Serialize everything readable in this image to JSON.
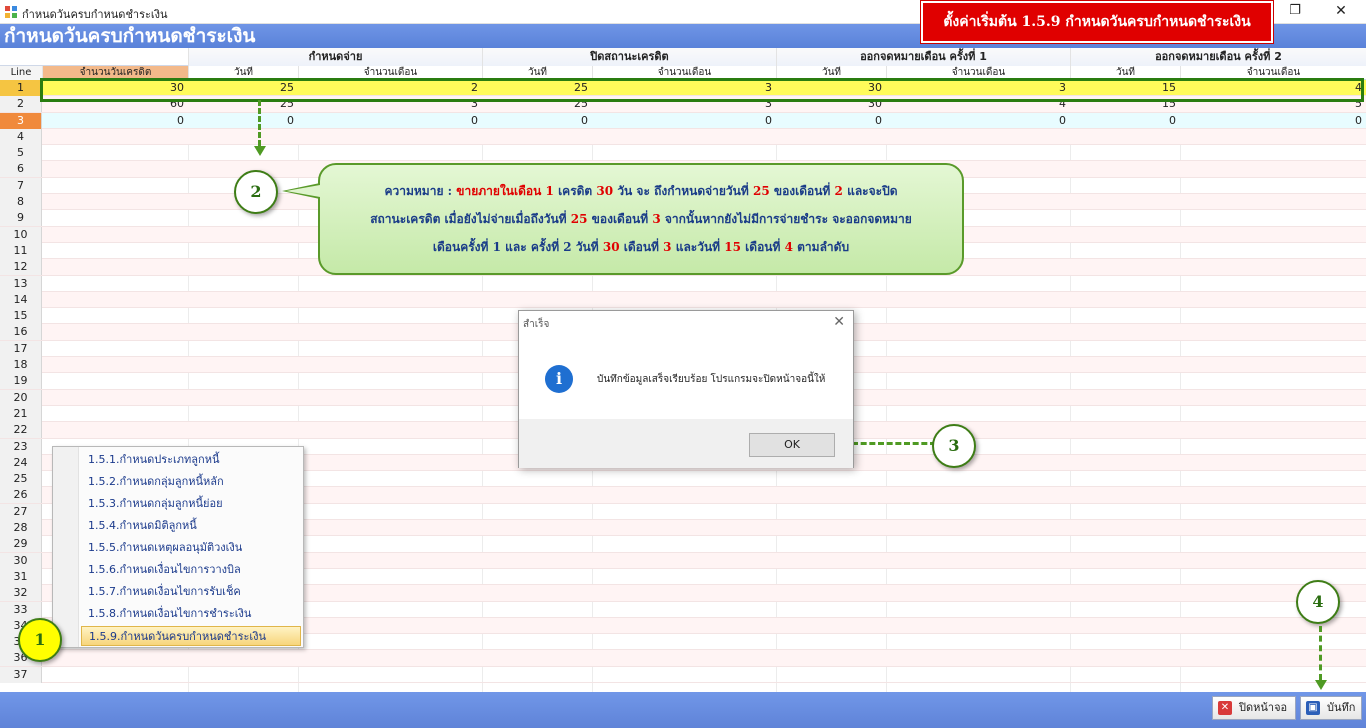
{
  "window": {
    "title": "กำหนดวันครบกำหนดชำระเงิน",
    "restore_glyph": "❐",
    "close_glyph": "✕"
  },
  "banner": {
    "text": "ตั้งค่าเริ่มต้น 1.5.9 กำหนดวันครบกำหนดชำระเงิน",
    "color": "#e00000"
  },
  "form": {
    "title": "กำหนดวันครบกำหนดชำระเงิน",
    "header_color": "#5a82d9"
  },
  "grid": {
    "line_header": "Line",
    "groups": [
      "กำหนดจ่าย",
      "ปิดสถานะเครดิต",
      "ออกจดหมายเดือน ครั้งที่ 1",
      "ออกจดหมายเดือน ครั้งที่ 2"
    ],
    "columns": [
      "จำนวนวันเครดิต",
      "วันที่",
      "จำนวนเดือน",
      "วันที่",
      "จำนวนเดือน",
      "วันที่",
      "จำนวนเดือน",
      "วันที่",
      "จำนวนเดือน"
    ],
    "rows": [
      [
        "30",
        "25",
        "2",
        "25",
        "3",
        "30",
        "3",
        "15",
        "4"
      ],
      [
        "60",
        "25",
        "3",
        "25",
        "3",
        "30",
        "4",
        "15",
        "5"
      ],
      [
        "0",
        "0",
        "0",
        "0",
        "0",
        "0",
        "0",
        "0",
        "0"
      ]
    ],
    "line_numbers": [
      "1",
      "2",
      "3",
      "4",
      "5",
      "6",
      "7",
      "8",
      "9",
      "10",
      "11",
      "12",
      "13",
      "14",
      "15",
      "16",
      "17",
      "18",
      "19",
      "20",
      "21",
      "22",
      "23",
      "24",
      "25",
      "26",
      "27",
      "28",
      "29",
      "30",
      "31",
      "32",
      "33",
      "34",
      "35",
      "36",
      "37"
    ]
  },
  "callout": {
    "label": "ความหมาย :",
    "line1_a": "ขายภายในเดือน",
    "line1_b": "1",
    "line1_c": "เครดิต",
    "line1_d": "30",
    "line1_e": "วัน จะ ถึงกำหนดจ่ายวันที่",
    "line1_f": "25",
    "line1_g": "ของเดือนที่",
    "line1_h": "2",
    "line1_i": "และจะปิด",
    "line2_a": "สถานะเครดิต เมื่อยังไม่จ่ายเมื่อถึงวันที่",
    "line2_b": "25",
    "line2_c": "ของเดือนที่",
    "line2_d": "3",
    "line2_e": "จากนั้นหากยังไม่มีการจ่ายชำระ จะออกจดหมาย",
    "line3_a": "เดือนครั้งที่ 1 และ ครั้งที่ 2 วันที่",
    "line3_b": "30",
    "line3_c": "เดือนที่",
    "line3_d": "3",
    "line3_e": "และวันที่",
    "line3_f": "15",
    "line3_g": "เดือนที่",
    "line3_h": "4",
    "line3_i": "ตามลำดับ"
  },
  "steps": [
    "1",
    "2",
    "3",
    "4"
  ],
  "dialog": {
    "title": "สำเร็จ",
    "message": "บันทึกข้อมูลเสร็จเรียบร้อย โปรแกรมจะปิดหน้าจอนี้ให้",
    "ok": "OK",
    "close_glyph": "✕",
    "info_glyph": "i"
  },
  "menu": {
    "items": [
      "1.5.1.กำหนดประเภทลูกหนี้",
      "1.5.2.กำหนดกลุ่มลูกหนี้หลัก",
      "1.5.3.กำหนดกลุ่มลูกหนี้ย่อย",
      "1.5.4.กำหนดมิติลูกหนี้",
      "1.5.5.กำหนดเหตุผลอนุมัติวงเงิน",
      "1.5.6.กำหนดเงื่อนไขการวางบิล",
      "1.5.7.กำหนดเงื่อนไขการรับเช็ค",
      "1.5.8.กำหนดเงื่อนไขการชำระเงิน",
      "1.5.9.กำหนดวันครบกำหนดชำระเงิน"
    ]
  },
  "footer": {
    "close_label": "ปิดหน้าจอ",
    "save_label": "บันทึก",
    "close_icon": "x-icon",
    "save_icon": "floppy-disk-icon"
  }
}
